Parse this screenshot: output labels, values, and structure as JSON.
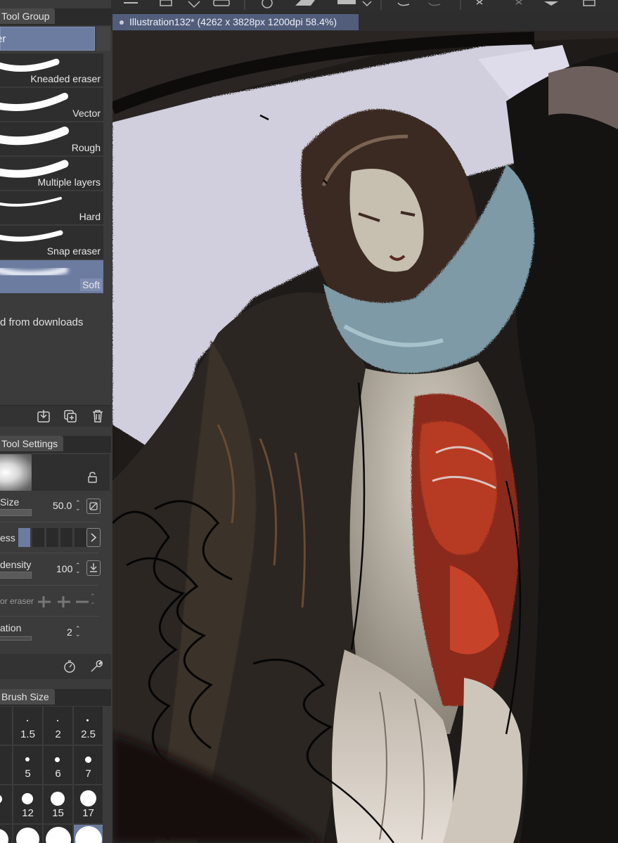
{
  "subtool_panel": {
    "tab_label": "Tool Group",
    "selected_subtool": "er",
    "brushes": [
      {
        "label": "Kneaded eraser"
      },
      {
        "label": "Vector"
      },
      {
        "label": "Rough"
      },
      {
        "label": "Multiple layers"
      },
      {
        "label": "Hard"
      },
      {
        "label": "Snap eraser"
      },
      {
        "label": "Soft",
        "selected": true
      }
    ],
    "downloads_label": "d from downloads",
    "icons": [
      "import-icon",
      "duplicate-icon",
      "trash-icon"
    ]
  },
  "tool_settings": {
    "tab_label": "Tool Settings",
    "size": {
      "label": "Size",
      "value": "50.0"
    },
    "hardness": {
      "label": "ess"
    },
    "density": {
      "label": "density",
      "value": "100"
    },
    "vector_eraser": {
      "label": "or eraser"
    },
    "stabilization": {
      "label": "ation",
      "value": "2"
    },
    "icons": [
      "gauge-icon",
      "wrench-icon"
    ]
  },
  "brush_size_panel": {
    "tab_label": "Brush Size",
    "sizes": [
      "",
      "1.5",
      "2",
      "2.5",
      "",
      "5",
      "6",
      "7",
      "0",
      "12",
      "15",
      "17",
      "",
      "",
      "",
      ""
    ]
  },
  "document": {
    "tab_title": "Illustration132* (4262 x 3828px 1200dpi 58.4%)"
  },
  "colors": {
    "accent": "#6c7ca0",
    "panel_bg": "#3b3b3b",
    "doc_tab": "#515d7b"
  }
}
